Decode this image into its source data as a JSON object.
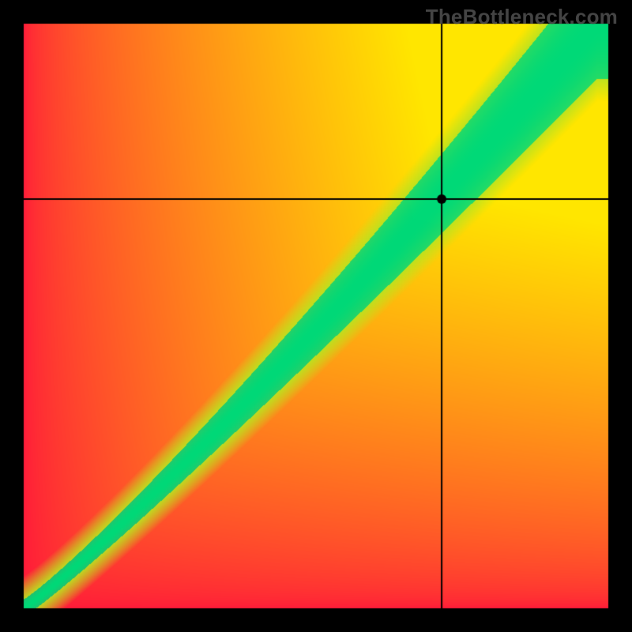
{
  "watermark": "TheBottleneck.com",
  "chart_data": {
    "type": "heatmap",
    "title": "",
    "xlabel": "",
    "ylabel": "",
    "canvas_size": 800,
    "plot_border": 30,
    "plot_inner_size": 740,
    "crosshair": {
      "x_frac": 0.715,
      "y_frac": 0.7
    },
    "dot_radius": 6,
    "green_band_desc": "Diagonal band from lower-left to upper-right indicating balanced (no-bottleneck) region; band widens and curves slightly upward toward the upper-right.",
    "colors": {
      "cold": "#ff1a3a",
      "warm": "#ffe600",
      "good": "#00d978",
      "border": "#000000",
      "crosshair": "#000000",
      "dot": "#000000"
    },
    "band": {
      "center_exponent": 1.1,
      "center_offset": 0.02,
      "half_width_min": 0.015,
      "half_width_max": 0.1,
      "soft_falloff": 0.04
    }
  }
}
